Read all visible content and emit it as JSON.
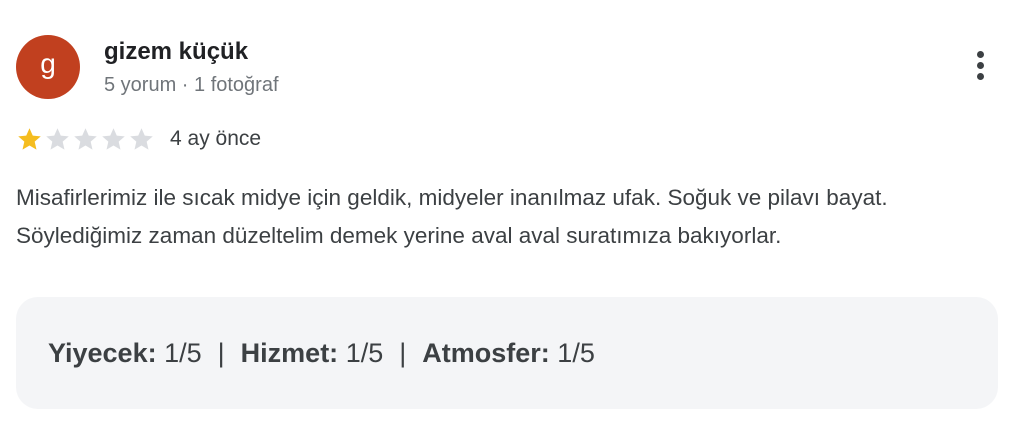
{
  "user": {
    "initial": "g",
    "avatar_color": "#c1401f",
    "name": "gizem küçük",
    "meta": "5 yorum · 1 fotoğraf"
  },
  "menu": {
    "icon": "more-vert-icon"
  },
  "rating": {
    "value": 1,
    "max": 5,
    "filled_color": "#f5bd1f",
    "empty_color": "#dadce0",
    "date": "4 ay önce"
  },
  "review": {
    "text": "Misafirlerimiz ile sıcak midye için geldik, midyeler inanılmaz ufak. Soğuk ve pilavı bayat. Söylediğimiz zaman düzeltelim demek yerine aval aval suratımıza bakıyorlar."
  },
  "attributes": [
    {
      "name": "Yiyecek:",
      "value": "1/5"
    },
    {
      "name": "Hizmet:",
      "value": "1/5"
    },
    {
      "name": "Atmosfer:",
      "value": "1/5"
    }
  ],
  "separator": "|"
}
